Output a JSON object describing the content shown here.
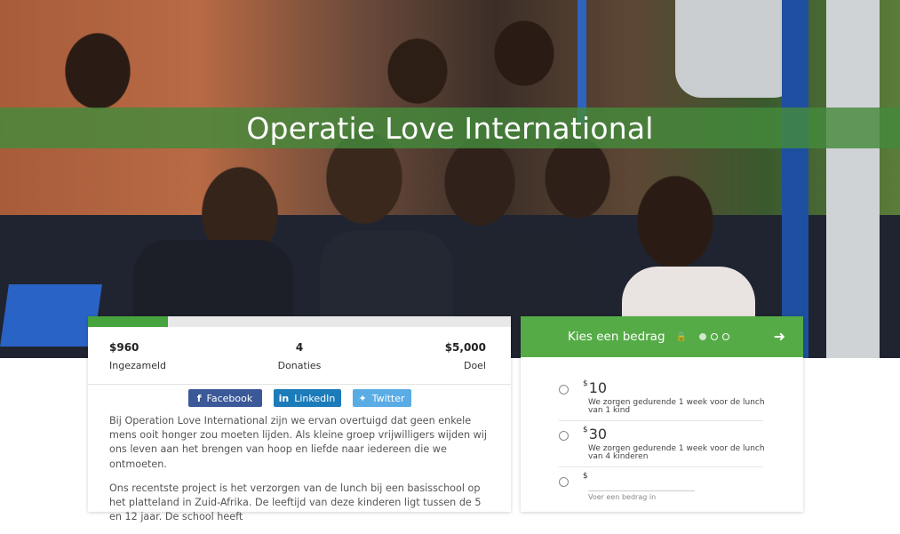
{
  "hero": {
    "title": "Operatie Love International"
  },
  "campaign": {
    "progress_fraction": 0.19,
    "stats": [
      {
        "value": "$960",
        "label": "Ingezameld"
      },
      {
        "value": "4",
        "label": "Donaties"
      },
      {
        "value": "$5,000",
        "label": "Doel"
      }
    ],
    "share": {
      "facebook": "Facebook",
      "linkedin": "LinkedIn",
      "twitter": "Twitter"
    },
    "description": [
      "Bij Operation Love International zijn we ervan overtuigd dat geen enkele mens ooit honger zou moeten lijden. Als kleine groep vrijwilligers wijden wij ons leven aan het brengen van hoop en liefde naar iedereen die we ontmoeten.",
      "Ons recentste project is het verzorgen van de lunch bij een basisschool op het platteland in Zuid-Afrika. De leeftijd van deze kinderen ligt tussen de 5 en 12 jaar. De school heeft"
    ]
  },
  "donate": {
    "title": "Kies een bedrag",
    "step_count": 3,
    "active_step": 1,
    "options": [
      {
        "currency": "$",
        "amount": "10",
        "text": "We zorgen gedurende 1 week voor de lunch van 1 kind"
      },
      {
        "currency": "$",
        "amount": "30",
        "text": "We zorgen gedurende 1 week voor de lunch van 4 kinderen"
      }
    ],
    "custom": {
      "currency": "$",
      "hint": "Voer een bedrag in"
    }
  },
  "colors": {
    "accent": "#55ac47",
    "facebook": "#3b5898",
    "linkedin": "#1c7bb9",
    "twitter": "#5aace5"
  }
}
